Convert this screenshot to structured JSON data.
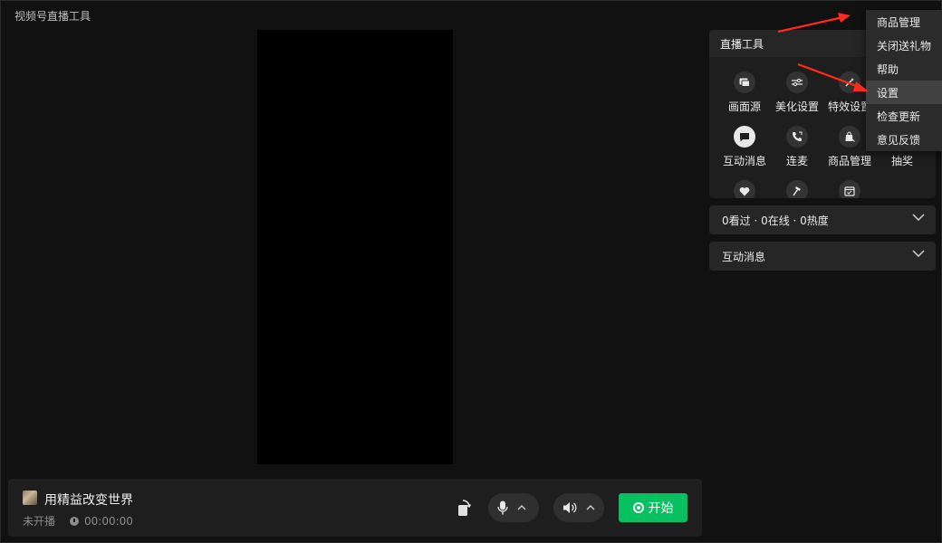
{
  "window": {
    "title": "视频号直播工具"
  },
  "bottom_bar": {
    "room_title": "用精益改变世界",
    "status": "未开播",
    "duration": "00:00:00",
    "start_label": "开始"
  },
  "tools_panel": {
    "header": "直播工具",
    "items": [
      {
        "label": "画面源",
        "icon": "screen-source-icon"
      },
      {
        "label": "美化设置",
        "icon": "beauty-sliders-icon"
      },
      {
        "label": "特效设置",
        "icon": "effects-icon"
      },
      {
        "label": "",
        "icon": "tool-icon"
      },
      {
        "label": "互动消息",
        "icon": "chat-bubble-icon"
      },
      {
        "label": "连麦",
        "icon": "phone-link-icon"
      },
      {
        "label": "商品管理",
        "icon": "shopping-bag-icon"
      },
      {
        "label": "抽奖",
        "icon": "lottery-icon"
      },
      {
        "label": "",
        "icon": "heart-icon"
      },
      {
        "label": "",
        "icon": "hammer-icon"
      },
      {
        "label": "",
        "icon": "calendar-icon"
      }
    ]
  },
  "stats_section": {
    "label": "0看过 · 0在线 · 0热度"
  },
  "messages_section": {
    "label": "互动消息"
  },
  "menu": {
    "items": [
      {
        "label": "商品管理"
      },
      {
        "label": "关闭送礼物"
      },
      {
        "label": "帮助"
      },
      {
        "label": "设置"
      },
      {
        "label": "检查更新"
      },
      {
        "label": "意见反馈"
      }
    ]
  },
  "colors": {
    "accent": "#07c160",
    "annotation_arrow": "#ff2a1a"
  }
}
